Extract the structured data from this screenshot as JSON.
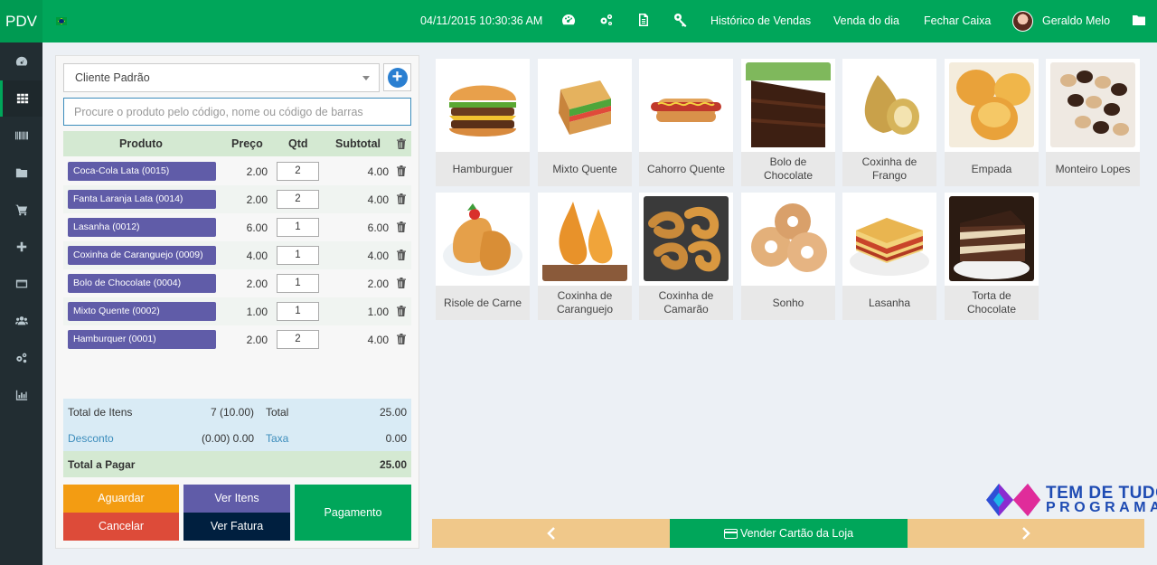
{
  "brand": "PDV",
  "topbar": {
    "datetime": "04/11/2015 10:30:36 AM",
    "icons": [
      "dashboard-icon",
      "gears-icon",
      "document-icon",
      "key-icon"
    ],
    "links": [
      "Histórico de Vendas",
      "Venda do dia",
      "Fechar Caixa"
    ],
    "user": "Geraldo Melo",
    "folder_icon": "folder-icon"
  },
  "sidebar": {
    "items": [
      "dashboard-icon",
      "grid-icon",
      "barcode-icon",
      "folder-icon",
      "cart-icon",
      "plus-icon",
      "credit-card-icon",
      "users-icon",
      "gears-icon",
      "bar-chart-icon"
    ],
    "active_index": 1
  },
  "client": {
    "selected": "Cliente Padrão"
  },
  "search": {
    "placeholder": "Procure o produto pelo código, nome ou código de barras"
  },
  "cart": {
    "headers": {
      "product": "Produto",
      "price": "Preço",
      "qty": "Qtd",
      "subtotal": "Subtotal"
    },
    "items": [
      {
        "name": "Coca-Cola Lata (0015)",
        "price": "2.00",
        "qty": "2",
        "subtotal": "4.00"
      },
      {
        "name": "Fanta Laranja Lata (0014)",
        "price": "2.00",
        "qty": "2",
        "subtotal": "4.00"
      },
      {
        "name": "Lasanha (0012)",
        "price": "6.00",
        "qty": "1",
        "subtotal": "6.00"
      },
      {
        "name": "Coxinha de Caranguejo (0009)",
        "price": "4.00",
        "qty": "1",
        "subtotal": "4.00"
      },
      {
        "name": "Bolo de Chocolate (0004)",
        "price": "2.00",
        "qty": "1",
        "subtotal": "2.00"
      },
      {
        "name": "Mixto Quente (0002)",
        "price": "1.00",
        "qty": "1",
        "subtotal": "1.00"
      },
      {
        "name": "Hamburquer (0001)",
        "price": "2.00",
        "qty": "2",
        "subtotal": "4.00"
      }
    ]
  },
  "totals": {
    "items_label": "Total de Itens",
    "items_value": "7 (10.00)",
    "total_label": "Total",
    "total_value": "25.00",
    "discount_label": "Desconto",
    "discount_value": "(0.00) 0.00",
    "tax_label": "Taxa",
    "tax_value": "0.00",
    "pay_label": "Total a Pagar",
    "pay_value": "25.00"
  },
  "actions": {
    "hold": "Aguardar",
    "cancel": "Cancelar",
    "view_items": "Ver Itens",
    "view_invoice": "Ver Fatura",
    "payment": "Pagamento"
  },
  "products": [
    {
      "name": "Hamburguer",
      "image": "hamburger"
    },
    {
      "name": "Mixto Quente",
      "image": "sandwich"
    },
    {
      "name": "Cahorro Quente",
      "image": "hotdog"
    },
    {
      "name": "Bolo de Chocolate",
      "image": "chocolate-cake"
    },
    {
      "name": "Coxinha de Frango",
      "image": "coxinha"
    },
    {
      "name": "Empada",
      "image": "empada"
    },
    {
      "name": "Monteiro Lopes",
      "image": "cookies"
    },
    {
      "name": "Risole de Carne",
      "image": "risole"
    },
    {
      "name": "Coxinha de Caranguejo",
      "image": "coxinha-caranguejo"
    },
    {
      "name": "Coxinha de Camarão",
      "image": "shrimp"
    },
    {
      "name": "Sonho",
      "image": "donuts"
    },
    {
      "name": "Lasanha",
      "image": "lasagna"
    },
    {
      "name": "Torta de Chocolate",
      "image": "chocolate-pie"
    }
  ],
  "bottom_nav": {
    "prev_icon": "chevron-left-icon",
    "store_card": "Vender Cartão da Loja",
    "next_icon": "chevron-right-icon"
  },
  "watermark": {
    "line1": "TEM DE TUDO",
    "line2": "PROGRAMAS"
  },
  "colors": {
    "primary": "#00a65a",
    "sidebar": "#222d32",
    "purple": "#605ca8",
    "orange": "#f39c12",
    "red": "#dd4b39",
    "navy": "#001f3f",
    "nav": "#f0c88a"
  }
}
